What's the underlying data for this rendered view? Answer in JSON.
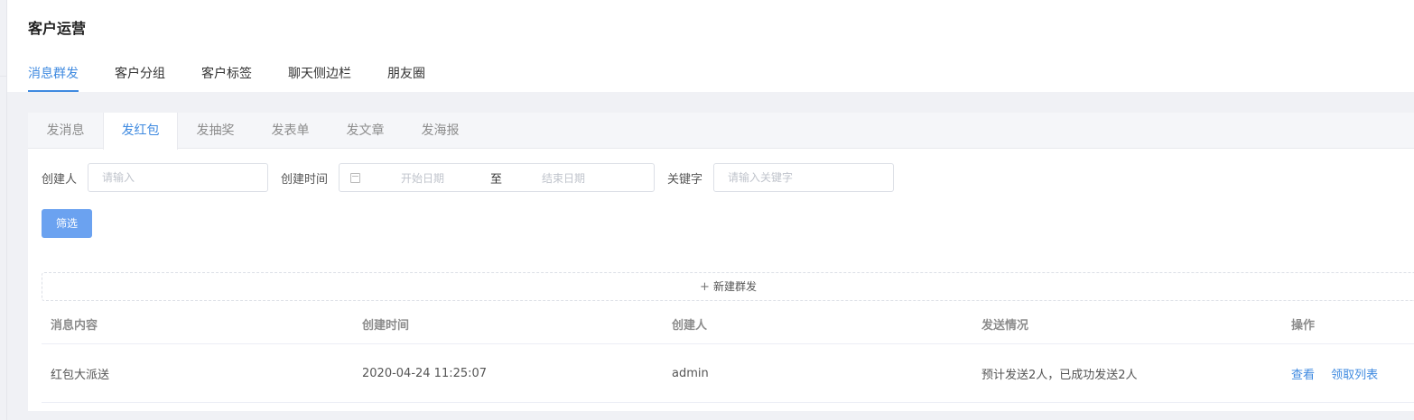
{
  "page": {
    "title": "客户运营"
  },
  "main_tabs": [
    {
      "label": "消息群发",
      "active": true
    },
    {
      "label": "客户分组",
      "active": false
    },
    {
      "label": "客户标签",
      "active": false
    },
    {
      "label": "聊天侧边栏",
      "active": false
    },
    {
      "label": "朋友圈",
      "active": false
    }
  ],
  "sub_tabs": [
    {
      "label": "发消息",
      "active": false
    },
    {
      "label": "发红包",
      "active": true
    },
    {
      "label": "发抽奖",
      "active": false
    },
    {
      "label": "发表单",
      "active": false
    },
    {
      "label": "发文章",
      "active": false
    },
    {
      "label": "发海报",
      "active": false
    }
  ],
  "filters": {
    "creator_label": "创建人",
    "creator_placeholder": "请输入",
    "time_label": "创建时间",
    "start_placeholder": "开始日期",
    "separator": "至",
    "end_placeholder": "结束日期",
    "keyword_label": "关键字",
    "keyword_placeholder": "请输入关键字",
    "filter_button": "筛选"
  },
  "new_group_label": "新建群发",
  "table": {
    "headers": [
      "消息内容",
      "创建时间",
      "创建人",
      "发送情况",
      "操作"
    ],
    "rows": [
      {
        "content": "红包大派送",
        "created_at": "2020-04-24 11:25:07",
        "creator": "admin",
        "status": "预计发送2人，已成功发送2人",
        "actions": [
          "查看",
          "领取列表"
        ]
      }
    ]
  },
  "colors": {
    "accent": "#3f8ae0",
    "button": "#6ba2f0"
  }
}
